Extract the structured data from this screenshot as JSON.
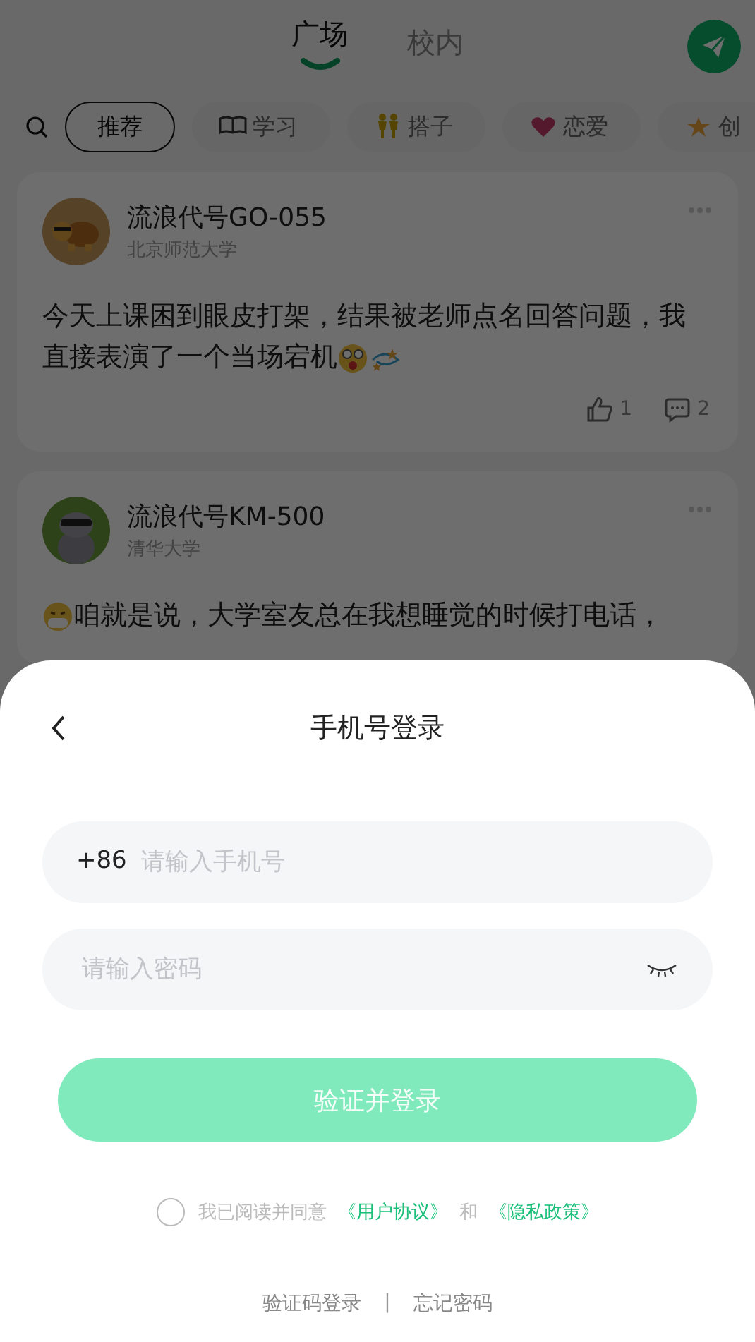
{
  "top_tabs": [
    {
      "label": "广场",
      "selected": true
    },
    {
      "label": "校内",
      "selected": false
    }
  ],
  "categories": [
    {
      "label": "推荐",
      "selected": true,
      "kind": "none"
    },
    {
      "label": "学习",
      "selected": false,
      "kind": "book"
    },
    {
      "label": "搭子",
      "selected": false,
      "kind": "people"
    },
    {
      "label": "恋爱",
      "selected": false,
      "kind": "heart"
    },
    {
      "label": "创",
      "selected": false,
      "kind": "star"
    }
  ],
  "posts": [
    {
      "author": "流浪代号GO-055",
      "school": "北京师范大学",
      "kind": "turtle",
      "lines": [
        [
          {
            "kind": "text",
            "text": "今天上课困到眼皮打架，结果被老师点名回答问题，我"
          }
        ],
        [
          {
            "kind": "text",
            "text": "直接表演了一个当场宕机"
          },
          {
            "kind": "shocked"
          },
          {
            "kind": "dizzy"
          }
        ]
      ],
      "likes": "1",
      "comments": "2"
    },
    {
      "author": "流浪代号KM-500",
      "school": "清华大学",
      "kind": "hippo",
      "lines": [
        [
          {
            "kind": "masked"
          },
          {
            "kind": "text",
            "text": "咱就是说，大学室友总在我想睡觉的时候打电话，"
          }
        ]
      ]
    }
  ],
  "login": {
    "title": "手机号登录",
    "phone": {
      "prefix": "+86",
      "placeholder": "请输入手机号"
    },
    "password": {
      "placeholder": "请输入密码"
    },
    "submit": {
      "label": "验证并登录",
      "disabled": true
    },
    "agreement": {
      "checked": false,
      "text": "我已阅读并同意",
      "link_1": "《用户协议》",
      "joiner": "和",
      "link_2": "《隐私政策》"
    },
    "footer": {
      "link_1": "验证码登录",
      "separator": "|",
      "link_2": "忘记密码"
    }
  }
}
